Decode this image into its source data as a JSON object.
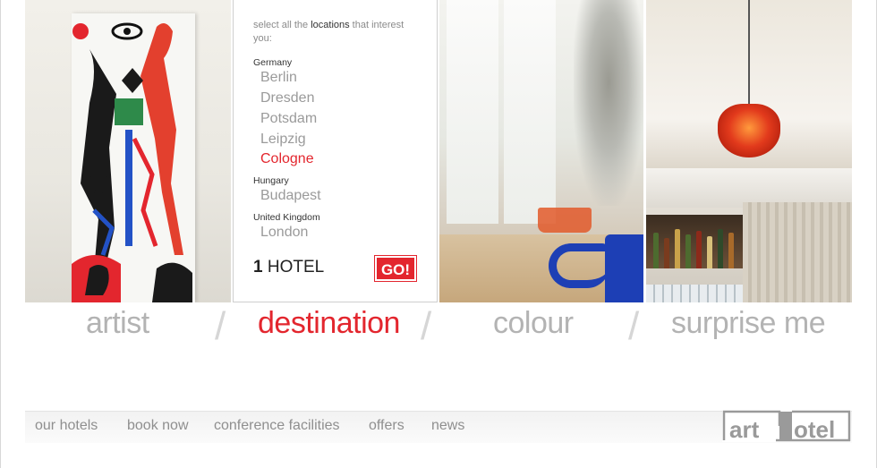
{
  "destination_panel": {
    "intro_pre": "select all the ",
    "intro_bold": "locations",
    "intro_post": " that interest you:",
    "groups": [
      {
        "country": "Germany",
        "cities": [
          "Berlin",
          "Dresden",
          "Potsdam",
          "Leipzig",
          "Cologne"
        ]
      },
      {
        "country": "Hungary",
        "cities": [
          "Budapest"
        ]
      },
      {
        "country": "United Kingdom",
        "cities": [
          "London"
        ]
      }
    ],
    "selected_city": "Cologne",
    "result_count": "1",
    "result_label": "HOTEL",
    "go_label": "GO!"
  },
  "categories": [
    {
      "label": "artist",
      "active": false
    },
    {
      "label": "destination",
      "active": true
    },
    {
      "label": "colour",
      "active": false
    },
    {
      "label": "surprise me",
      "active": false
    }
  ],
  "footer_nav": [
    "our hotels",
    "book now",
    "conference facilities",
    "offers",
    "news"
  ],
  "logo": {
    "part1": "art",
    "part2": "otel"
  },
  "colors": {
    "accent_red": "#e3262e",
    "muted_text": "#8f8f8f",
    "category_grey": "#b3b3b3"
  }
}
